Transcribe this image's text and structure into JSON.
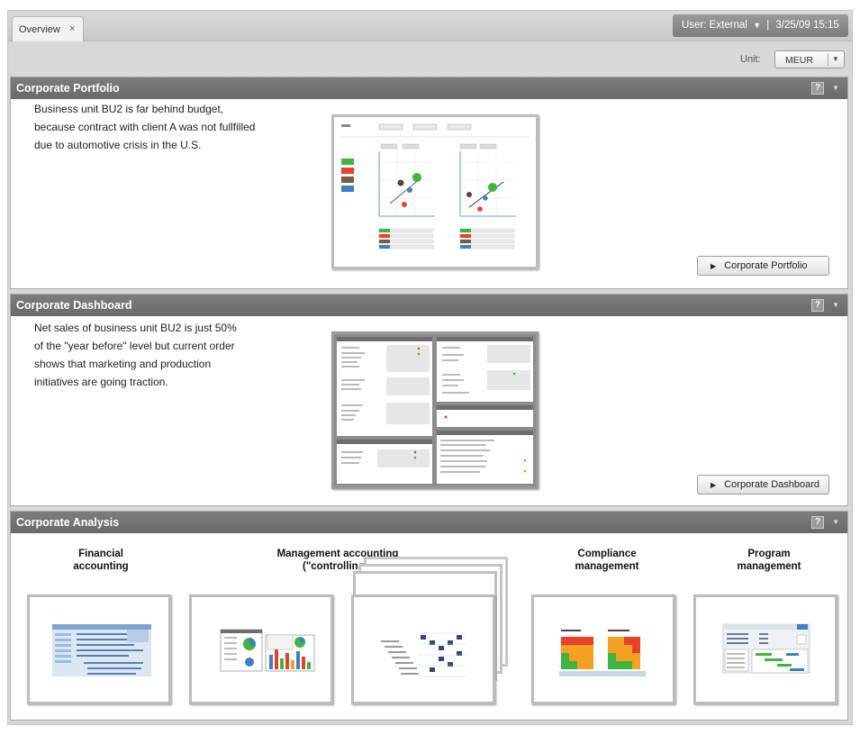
{
  "tabs": [
    {
      "label": "Overview",
      "close": "×"
    }
  ],
  "user_box": {
    "text": "User: External",
    "caret": "▼",
    "separator": "|",
    "datetime": "3/25/09 15:15"
  },
  "unit": {
    "label": "Unit:",
    "value": "MEUR",
    "arrow": "▼"
  },
  "panels": {
    "portfolio": {
      "title": "Corporate Portfolio",
      "help": "?",
      "caret": "▼",
      "text": [
        "Business unit BU2 is far behind budget,",
        "because contract with client A was not fullfilled",
        "due to automotive crisis in the U.S."
      ],
      "button": "Corporate Portfolio",
      "button_icon": "▶"
    },
    "dashboard": {
      "title": "Corporate Dashboard",
      "help": "?",
      "caret": "▼",
      "text": [
        "Net sales of business unit BU2 is just 50%",
        "of the \"year before\" level but current order",
        "shows that marketing and production",
        "initiatives are going traction."
      ],
      "button": "Corporate Dashboard",
      "button_icon": "▶"
    },
    "analysis": {
      "title": "Corporate Analysis",
      "help": "?",
      "caret": "▼",
      "areas": [
        {
          "line1": "Financial",
          "line2": "accounting"
        },
        {
          "line1": "Management accounting",
          "line2": "(\"controlling\")"
        },
        {
          "line1": "Compliance",
          "line2": "management"
        },
        {
          "line1": "Program",
          "line2": "management"
        }
      ]
    }
  },
  "colors": {
    "header": "#737373",
    "accent_green": "#3fb53f",
    "accent_red": "#e8402c",
    "accent_orange": "#f5a020",
    "accent_blue": "#3d7fc4"
  }
}
